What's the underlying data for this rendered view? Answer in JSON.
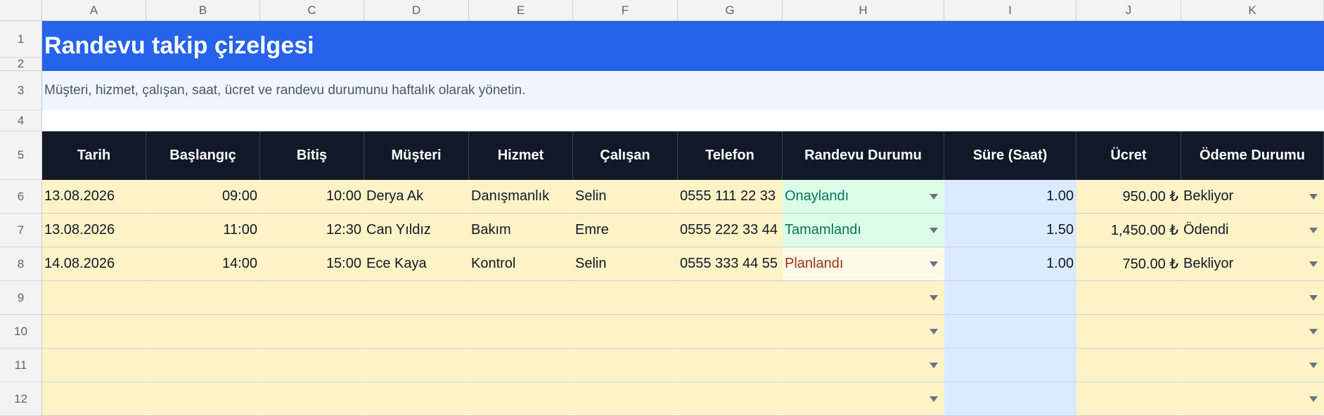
{
  "sheet": {
    "columns": [
      "A",
      "B",
      "C",
      "D",
      "E",
      "F",
      "G",
      "H",
      "I",
      "J",
      "K"
    ],
    "rows": [
      "1",
      "2",
      "3",
      "4",
      "5",
      "6",
      "7",
      "8",
      "9",
      "10",
      "11",
      "12"
    ],
    "title": "Randevu takip çizelgesi",
    "subtitle": "Müşteri, hizmet, çalışan, saat, ücret ve randevu durumunu haftalık olarak yönetin.",
    "headers": [
      "Tarih",
      "Başlangıç",
      "Bitiş",
      "Müşteri",
      "Hizmet",
      "Çalışan",
      "Telefon",
      "Randevu Durumu",
      "Süre (Saat)",
      "Ücret",
      "Ödeme Durumu"
    ],
    "data": [
      {
        "tarih": "13.08.2026",
        "baslangic": "09:00",
        "bitis": "10:00",
        "musteri": "Derya Ak",
        "hizmet": "Danışmanlık",
        "calisan": "Selin",
        "telefon": "0555 111 22 33",
        "durum": "Onaylandı",
        "sure": "1.00",
        "ucret": "950.00 ₺",
        "odeme": "Bekliyor"
      },
      {
        "tarih": "13.08.2026",
        "baslangic": "11:00",
        "bitis": "12:30",
        "musteri": "Can Yıldız",
        "hizmet": "Bakım",
        "calisan": "Emre",
        "telefon": "0555 222 33 44",
        "durum": "Tamamlandı",
        "sure": "1.50",
        "ucret": "1,450.00 ₺",
        "odeme": "Ödendi"
      },
      {
        "tarih": "14.08.2026",
        "baslangic": "14:00",
        "bitis": "15:00",
        "musteri": "Ece Kaya",
        "hizmet": "Kontrol",
        "calisan": "Selin",
        "telefon": "0555 333 44 55",
        "durum": "Planlandı",
        "sure": "1.00",
        "ucret": "750.00 ₺",
        "odeme": "Bekliyor"
      }
    ]
  },
  "colors": {
    "title_bg": "#2563eb",
    "subtitle_bg": "#eff6ff",
    "header_bg": "#111827",
    "input_bg": "#fef3c7",
    "calc_bg": "#dbeafe",
    "status_confirmed": "#047857",
    "status_planned": "#9a3412"
  },
  "icons": {
    "dropdown": "chevron-down-icon"
  }
}
